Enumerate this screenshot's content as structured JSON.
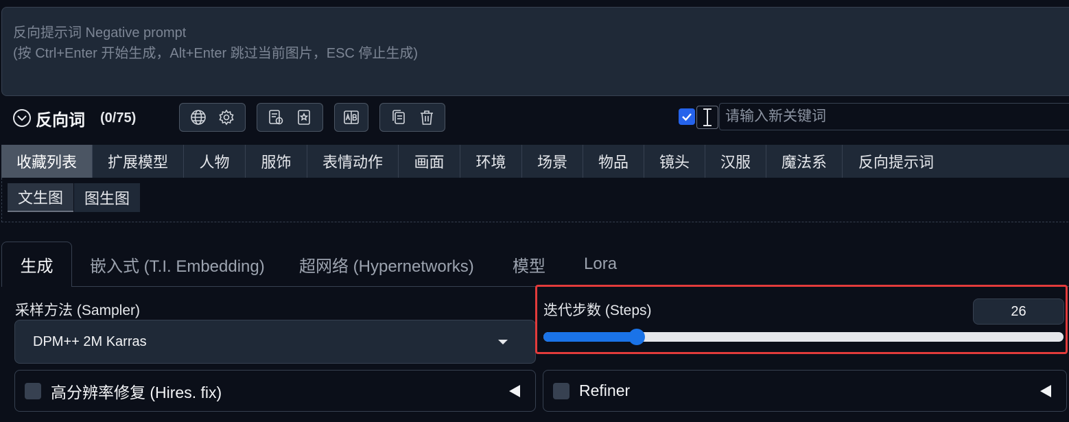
{
  "negative_prompt": {
    "placeholder_line1": "反向提示词 Negative prompt",
    "placeholder_line2": "(按 Ctrl+Enter 开始生成，Alt+Enter 跳过当前图片，ESC 停止生成)"
  },
  "toolbar": {
    "title": "反向词",
    "count": "(0/75)",
    "keyword_placeholder": "请输入新关键词",
    "keyword_enabled": true
  },
  "categories": [
    "收藏列表",
    "扩展模型",
    "人物",
    "服饰",
    "表情动作",
    "画面",
    "环境",
    "场景",
    "物品",
    "镜头",
    "汉服",
    "魔法系",
    "反向提示词"
  ],
  "active_category": 0,
  "subtabs": [
    "文生图",
    "图生图"
  ],
  "main_tabs": [
    "生成",
    "嵌入式 (T.I. Embedding)",
    "超网络 (Hypernetworks)",
    "模型",
    "Lora"
  ],
  "sampler": {
    "label": "采样方法 (Sampler)",
    "value": "DPM++ 2M Karras"
  },
  "steps": {
    "label": "迭代步数 (Steps)",
    "value": "26",
    "fraction": 0.18
  },
  "accordions": {
    "hires": "高分辨率修复 (Hires. fix)",
    "refiner": "Refiner"
  },
  "colors": {
    "accent": "#1a73e8",
    "highlight": "#e23b3b",
    "background": "#0b0f19"
  }
}
